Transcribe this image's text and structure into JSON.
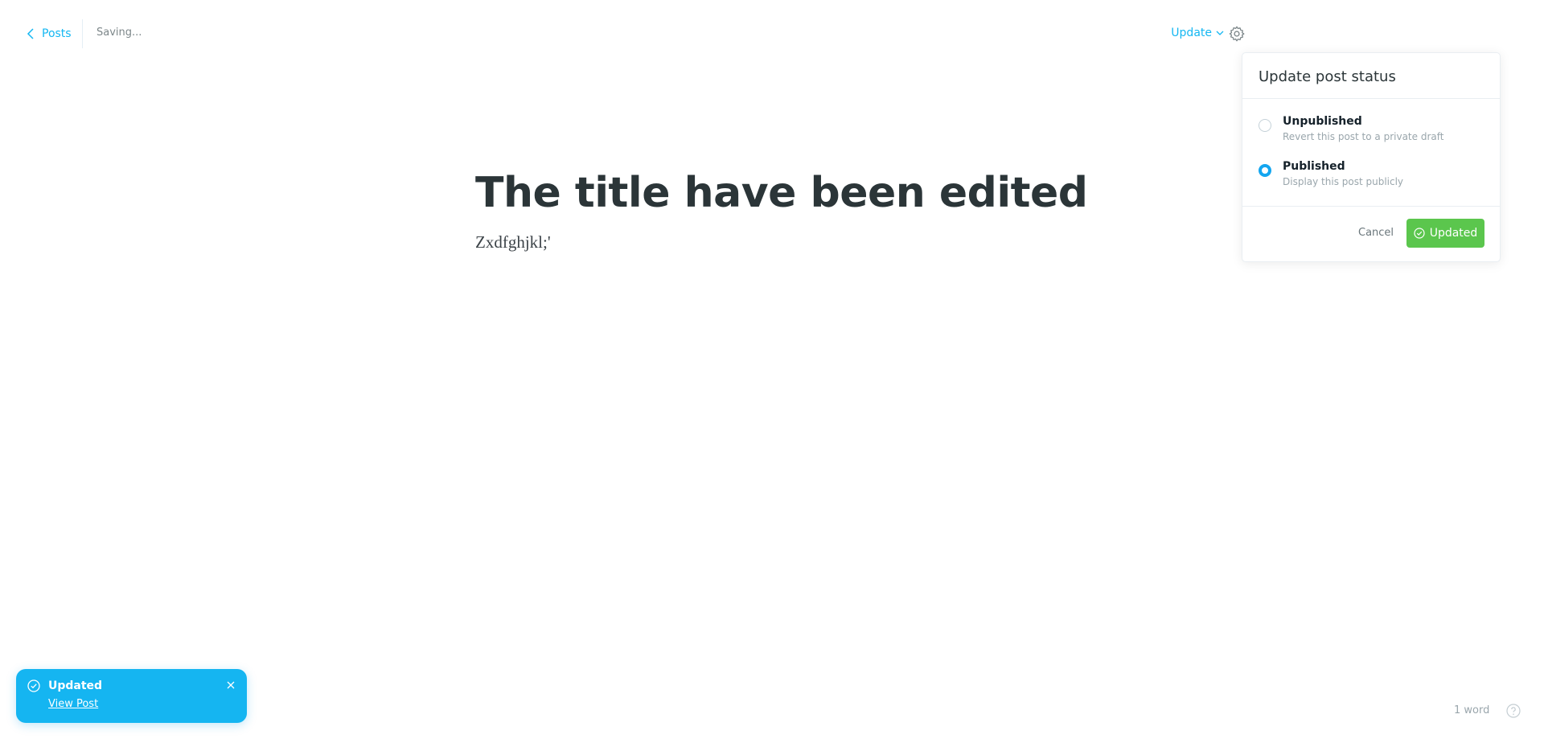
{
  "header": {
    "back_label": "Posts",
    "status_text": "Saving...",
    "update_label": "Update"
  },
  "editor": {
    "title": "The title have been edited",
    "body": "Zxdfghjkl;'"
  },
  "status_panel": {
    "title": "Update post status",
    "options": [
      {
        "label": "Unpublished",
        "description": "Revert this post to a private draft",
        "checked": false
      },
      {
        "label": "Published",
        "description": "Display this post publicly",
        "checked": true
      }
    ],
    "cancel_label": "Cancel",
    "confirm_label": "Updated"
  },
  "toast": {
    "title": "Updated",
    "link_label": "View Post"
  },
  "footer": {
    "word_count": "1 word"
  },
  "colors": {
    "accent": "#14b7f2",
    "success": "#5bc64d",
    "toast_bg": "#15b5f1"
  }
}
